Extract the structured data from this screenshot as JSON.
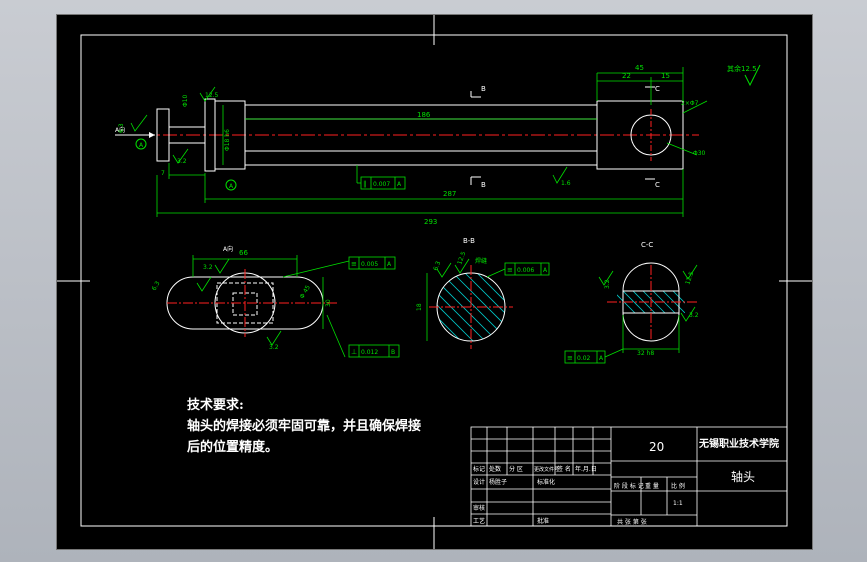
{
  "colors": {
    "background": "#000000",
    "outline": "#ffffff",
    "dimension": "#00e000",
    "centerline": "#ff2020",
    "hatch": "#00c8c8"
  },
  "roughness_note": "其余12.5",
  "front_view": {
    "section_b": "B",
    "section_c": "C",
    "section_b_low": "B",
    "section_c_low": "C",
    "view_a": "A向",
    "datum_a": "A",
    "dim_overall": "293",
    "dim_287": "287",
    "dim_186": "186",
    "dim_45": "45",
    "dim_22": "22",
    "dim_15": "15",
    "dim_hole": "2×Φ7",
    "dim_diam_30": "Φ30",
    "dim_diam_10": "Φ10",
    "dim_7": "7",
    "dim_diam_18": "Φ18 h6",
    "rough_63": "6.3",
    "rough_32": "3.2",
    "rough_16": "1.6",
    "rough_125": "12.5",
    "tol_frame_symbol": "∥",
    "tol_frame_value": "0.007",
    "tol_frame_datum": "A"
  },
  "view_a": {
    "label": "A向",
    "dim_66": "66",
    "dim_30": "30",
    "dim_45": "Φ 45",
    "rough_32": "3.2",
    "rough_63": "6.3",
    "rough_32b": "3.2",
    "tol1_value": "0.005",
    "tol1_datum": "A",
    "tol2_value": "0.012",
    "tol2_datum": "B"
  },
  "section_bb": {
    "label": "B-B",
    "dim_18": "18",
    "rough_63": "6.3",
    "rough_125": "12.5",
    "note_weld": "焊缝",
    "tol_value": "0.006",
    "tol_datum": "A"
  },
  "section_cc": {
    "label": "C-C",
    "dim_32": "32 h8",
    "rough_32a": "3.2",
    "rough_32b": "3.2",
    "rough_125": "12.5",
    "tol_value": "0.02",
    "tol_datum": "A"
  },
  "tech_requirements": {
    "heading": "技术要求:",
    "line1": "轴头的焊接必须牢固可靠，并且确保焊接",
    "line2": "后的位置精度。"
  },
  "title_block": {
    "drawing_number": "20",
    "school": "无锡职业技术学院",
    "part_name": "轴头",
    "scale": "1:1",
    "row_headers": [
      "标记",
      "处数",
      "分 区",
      "更改文件号",
      "签 名",
      "年.月.日"
    ],
    "designer_label": "设计",
    "designer_name": "杨胜子",
    "standard_label": "标准化",
    "reviewer_label": "审核",
    "process_label": "工艺",
    "approve_label": "批准",
    "stage_label": "阶 段 标 记",
    "weight_label": "重 量",
    "scale_label": "比 例",
    "sheets_label": "共    张  第    张"
  }
}
